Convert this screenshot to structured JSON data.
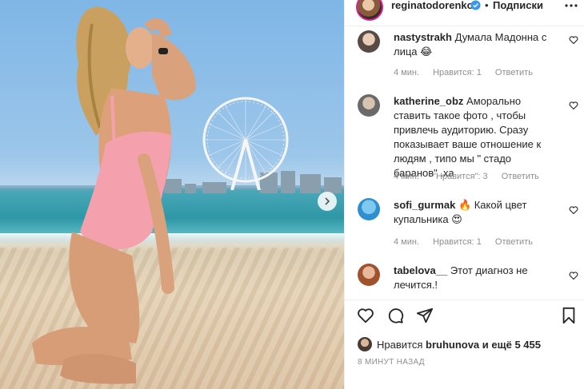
{
  "post": {
    "author": "reginatodorenko",
    "separator": "•",
    "follow_label": "Подписки"
  },
  "comments": [
    {
      "username": "nastystrakh",
      "text": "Думала Мадонна с лица 😂",
      "time": "4 мин.",
      "likes": "Нравится: 1",
      "reply": "Ответить"
    },
    {
      "username": "katherine_obz",
      "text": "Аморально ставить такое фото , чтобы привлечь аудиторию. Сразу показывает ваше отношение к людям , типо мы \" стадо баранов\" .ха",
      "time": "4 мин.",
      "likes": "\"Нравится\": 3",
      "reply": "Ответить"
    },
    {
      "username": "sofi_gurmak",
      "text": "🔥 Какой цвет купальника 😍",
      "time": "4 мин.",
      "likes": "Нравится: 1",
      "reply": "Ответить"
    },
    {
      "username": "tabelova__",
      "text": "Этот диагноз не лечится.!",
      "time": "",
      "likes": "",
      "reply": ""
    }
  ],
  "likes": {
    "prefix": "Нравится",
    "user": "bruhunova",
    "suffix": "и ещё 5 455"
  },
  "time_ago": "8 МИНУТ НАЗАД",
  "icons": {
    "like": "heart-icon",
    "comment": "comment-icon",
    "share": "paper-plane-icon",
    "save": "bookmark-icon",
    "verified": "verified-badge-icon",
    "more": "more-options-icon",
    "next": "chevron-right-icon"
  },
  "colors": {
    "verified": "#3897f0",
    "meta": "#8e8e8e",
    "text": "#262626"
  }
}
